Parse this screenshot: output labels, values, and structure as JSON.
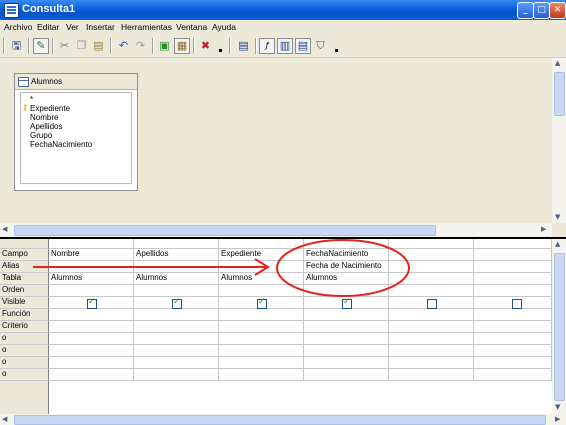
{
  "window": {
    "title": "Consulta1"
  },
  "menu": [
    "Archivo",
    "Editar",
    "Ver",
    "Insertar",
    "Herramientas",
    "Ventana",
    "Ayuda"
  ],
  "toolbar_icons": [
    "save-icon",
    "edit-icon",
    "cut-icon",
    "copy-icon",
    "paste-icon",
    "undo-icon",
    "redo-icon",
    "run-query-icon",
    "clear-query-icon",
    "delete-icon",
    "add-table-icon",
    "functions-icon",
    "table-name-icon",
    "alias-icon",
    "distinct-icon"
  ],
  "table": {
    "name": "Alumnos",
    "fields": [
      "*",
      "Expediente",
      "Nombre",
      "Apellidos",
      "Grupo",
      "FechaNacimiento"
    ],
    "key_field": "Expediente"
  },
  "grid": {
    "row_headers": [
      "Campo",
      "Alias",
      "Tabla",
      "Orden",
      "Visible",
      "Función",
      "Criterio",
      "o",
      "o",
      "o",
      "o"
    ],
    "columns": [
      {
        "campo": "Nombre",
        "alias": "",
        "tabla": "Alumnos",
        "visible": true
      },
      {
        "campo": "Apellidos",
        "alias": "",
        "tabla": "Alumnos",
        "visible": true
      },
      {
        "campo": "Expediente",
        "alias": "",
        "tabla": "Alumnos",
        "visible": true
      },
      {
        "campo": "FechaNacimiento",
        "alias": "Fecha de Nacimiento",
        "tabla": "Alumnos",
        "visible": true
      },
      {
        "campo": "",
        "alias": "",
        "tabla": "",
        "visible": false
      },
      {
        "campo": "",
        "alias": "",
        "tabla": "",
        "visible": false
      }
    ]
  },
  "colors": {
    "annotation": "#e8231b",
    "titlebar": "#0a5fd8"
  }
}
